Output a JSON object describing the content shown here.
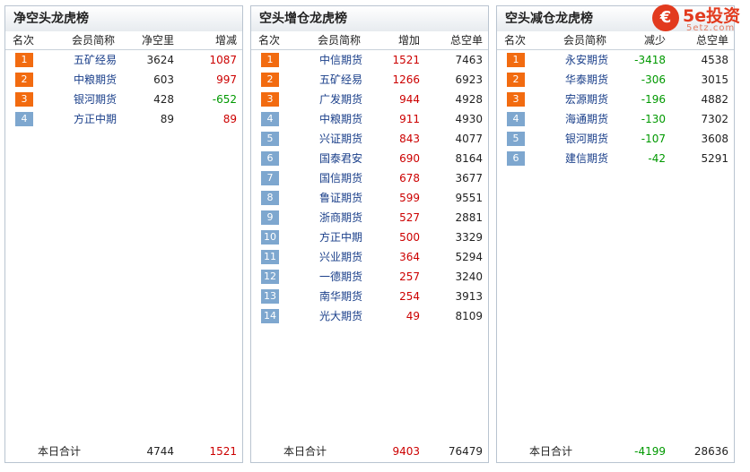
{
  "logo": {
    "main": "5e投资",
    "sub": "5etz.com"
  },
  "panels": [
    {
      "title": "净空头龙虎榜",
      "headers": [
        "名次",
        "会员简称",
        "净空里",
        "增减"
      ],
      "rows": [
        {
          "rank": "1",
          "name": "五矿经易",
          "v3": "3624",
          "v4": "1087",
          "v4_color": "red"
        },
        {
          "rank": "2",
          "name": "中粮期货",
          "v3": "603",
          "v4": "997",
          "v4_color": "red"
        },
        {
          "rank": "3",
          "name": "银河期货",
          "v3": "428",
          "v4": "-652",
          "v4_color": "green"
        },
        {
          "rank": "4",
          "name": "方正中期",
          "v3": "89",
          "v4": "89",
          "v4_color": "red"
        }
      ],
      "total": {
        "label": "本日合计",
        "v3": "4744",
        "v4": "1521",
        "v3_color": "black",
        "v4_color": "red"
      }
    },
    {
      "title": "空头增仓龙虎榜",
      "headers": [
        "名次",
        "会员简称",
        "增加",
        "总空单"
      ],
      "rows": [
        {
          "rank": "1",
          "name": "中信期货",
          "v3": "1521",
          "v4": "7463"
        },
        {
          "rank": "2",
          "name": "五矿经易",
          "v3": "1266",
          "v4": "6923"
        },
        {
          "rank": "3",
          "name": "广发期货",
          "v3": "944",
          "v4": "4928"
        },
        {
          "rank": "4",
          "name": "中粮期货",
          "v3": "911",
          "v4": "4930"
        },
        {
          "rank": "5",
          "name": "兴证期货",
          "v3": "843",
          "v4": "4077"
        },
        {
          "rank": "6",
          "name": "国泰君安",
          "v3": "690",
          "v4": "8164"
        },
        {
          "rank": "7",
          "name": "国信期货",
          "v3": "678",
          "v4": "3677"
        },
        {
          "rank": "8",
          "name": "鲁证期货",
          "v3": "599",
          "v4": "9551"
        },
        {
          "rank": "9",
          "name": "浙商期货",
          "v3": "527",
          "v4": "2881"
        },
        {
          "rank": "10",
          "name": "方正中期",
          "v3": "500",
          "v4": "3329"
        },
        {
          "rank": "11",
          "name": "兴业期货",
          "v3": "364",
          "v4": "5294"
        },
        {
          "rank": "12",
          "name": "一德期货",
          "v3": "257",
          "v4": "3240"
        },
        {
          "rank": "13",
          "name": "南华期货",
          "v3": "254",
          "v4": "3913"
        },
        {
          "rank": "14",
          "name": "光大期货",
          "v3": "49",
          "v4": "8109"
        }
      ],
      "v3_color": "red",
      "total": {
        "label": "本日合计",
        "v3": "9403",
        "v4": "76479",
        "v3_color": "red",
        "v4_color": "black"
      }
    },
    {
      "title": "空头减仓龙虎榜",
      "headers": [
        "名次",
        "会员简称",
        "减少",
        "总空单"
      ],
      "rows": [
        {
          "rank": "1",
          "name": "永安期货",
          "v3": "-3418",
          "v4": "4538"
        },
        {
          "rank": "2",
          "name": "华泰期货",
          "v3": "-306",
          "v4": "3015"
        },
        {
          "rank": "3",
          "name": "宏源期货",
          "v3": "-196",
          "v4": "4882"
        },
        {
          "rank": "4",
          "name": "海通期货",
          "v3": "-130",
          "v4": "7302"
        },
        {
          "rank": "5",
          "name": "银河期货",
          "v3": "-107",
          "v4": "3608"
        },
        {
          "rank": "6",
          "name": "建信期货",
          "v3": "-42",
          "v4": "5291"
        }
      ],
      "v3_color": "green",
      "total": {
        "label": "本日合计",
        "v3": "-4199",
        "v4": "28636",
        "v3_color": "green",
        "v4_color": "black"
      }
    }
  ]
}
